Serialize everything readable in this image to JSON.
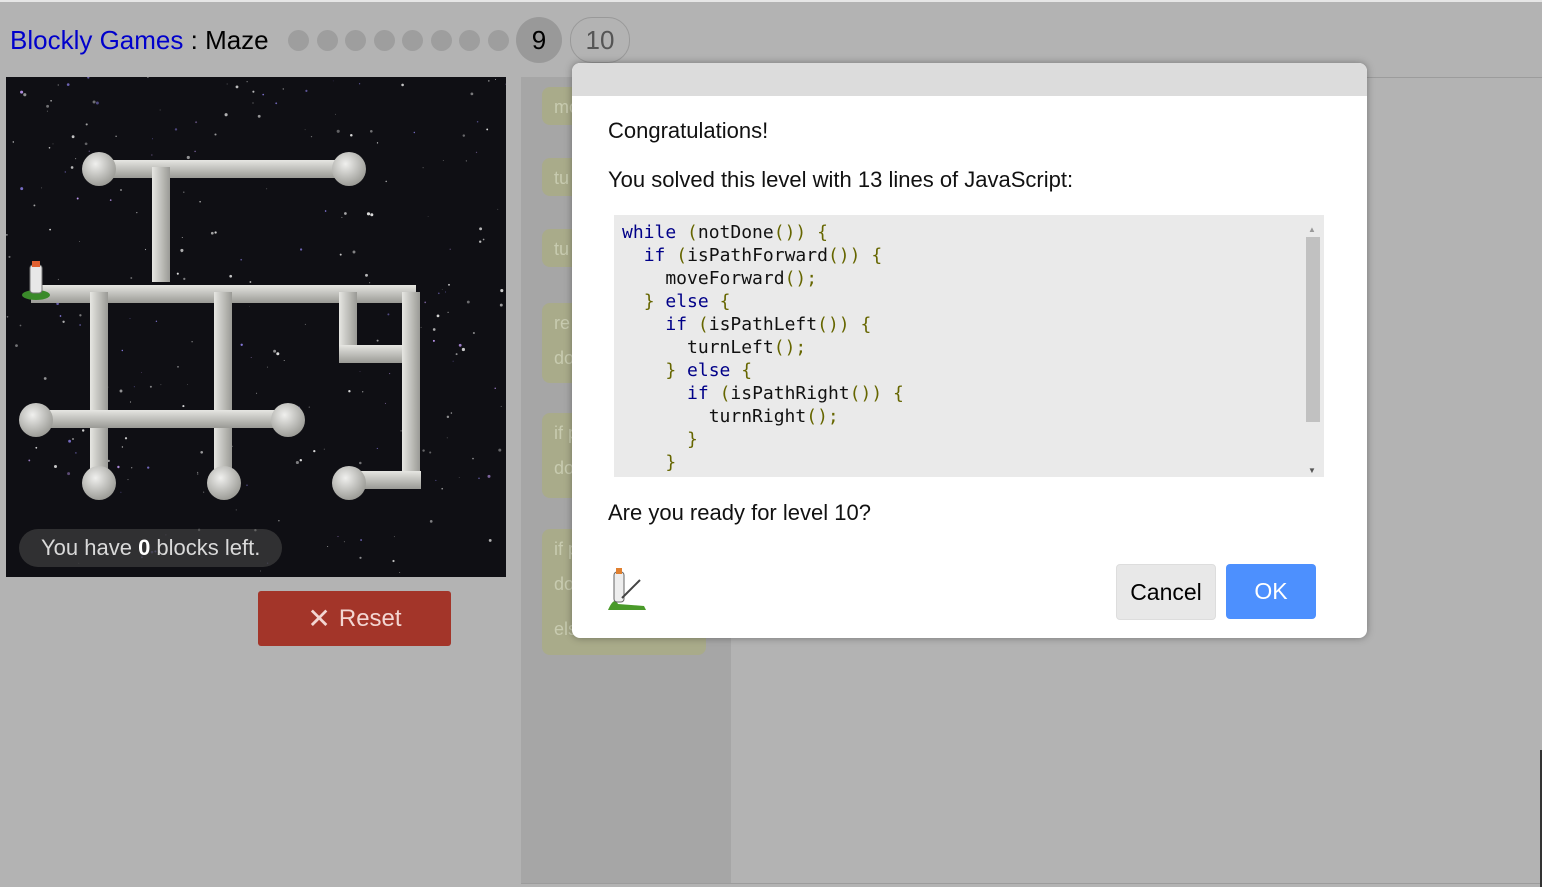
{
  "header": {
    "app_link": "Blockly Games",
    "separator": " : ",
    "game": "Maze",
    "completed_levels": [
      1,
      2,
      3,
      4,
      5,
      6,
      7,
      8
    ],
    "current_level": "9",
    "next_level": "10"
  },
  "maze": {
    "capacity_prefix": "You have ",
    "capacity_count": "0",
    "capacity_suffix": " blocks left."
  },
  "controls": {
    "reset_icon": "close-icon",
    "reset_label": "Reset"
  },
  "toolbox": {
    "blocks": [
      {
        "lines": [
          "mo"
        ]
      },
      {
        "lines": [
          "tu"
        ]
      },
      {
        "lines": [
          "tu"
        ]
      },
      {
        "lines": [
          "re",
          "do"
        ]
      },
      {
        "lines": [
          "if p",
          "do"
        ]
      },
      {
        "lines": [
          "if p",
          "do",
          "els"
        ]
      }
    ]
  },
  "dialog": {
    "congrats": "Congratulations!",
    "solved_text": "You solved this level with 13 lines of JavaScript:",
    "code_lines": [
      "while (notDone()) {",
      "  if (isPathForward()) {",
      "    moveForward();",
      "  } else {",
      "    if (isPathLeft()) {",
      "      turnLeft();",
      "    } else {",
      "      if (isPathRight()) {",
      "        turnRight();",
      "      }",
      "    }"
    ],
    "question": "Are you ready for level 10?",
    "cancel_label": "Cancel",
    "ok_label": "OK",
    "ok_color": "#4d90fe",
    "icon": "pegman-icon"
  },
  "colors": {
    "background": "#b3b3b3",
    "link": "#0000cc",
    "reset": "#a33529"
  }
}
